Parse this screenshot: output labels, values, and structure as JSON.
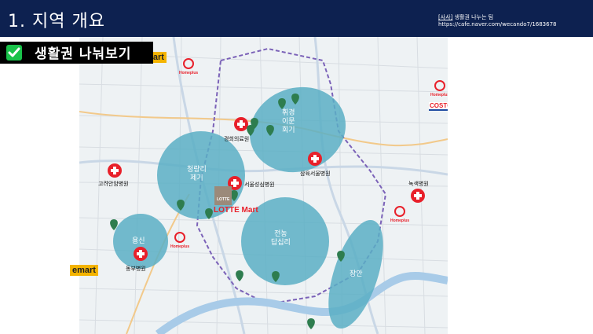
{
  "header": {
    "title": "1. 지역 개요",
    "source_tag": "[사사]",
    "source_text": " 생활권 나누는 팀",
    "source_url": "https://cafe.naver.com/wecando7/1683678"
  },
  "section": {
    "title": "생활권 나눠보기"
  },
  "zones": [
    {
      "label": "청량리\n제기"
    },
    {
      "label": "휘경\n이문\n회기"
    },
    {
      "label": "용신"
    },
    {
      "label": "전농\n답십리"
    },
    {
      "label": "장안"
    }
  ],
  "places": {
    "hosp_kyunghee": "경희의료원",
    "hosp_samyuk": "삼육서울병원",
    "hosp_korea": "고려안암병원",
    "hosp_seoulsungsim": "서울성심병원",
    "hosp_dongbu": "동부병원",
    "hosp_nokseak": "녹색병원"
  },
  "brands": {
    "emart": "emart",
    "homeplus": "Homeplus",
    "costco": "COSTCO",
    "lotte": "LOTTE Mart",
    "lotte_small": "LOTTE"
  },
  "colors": {
    "header_bg": "#0d2150",
    "zone_fill": "#5aafc4",
    "hospital_red": "#e8202a",
    "pin_green": "#2e7d4f",
    "emart_yellow": "#f4b400"
  }
}
